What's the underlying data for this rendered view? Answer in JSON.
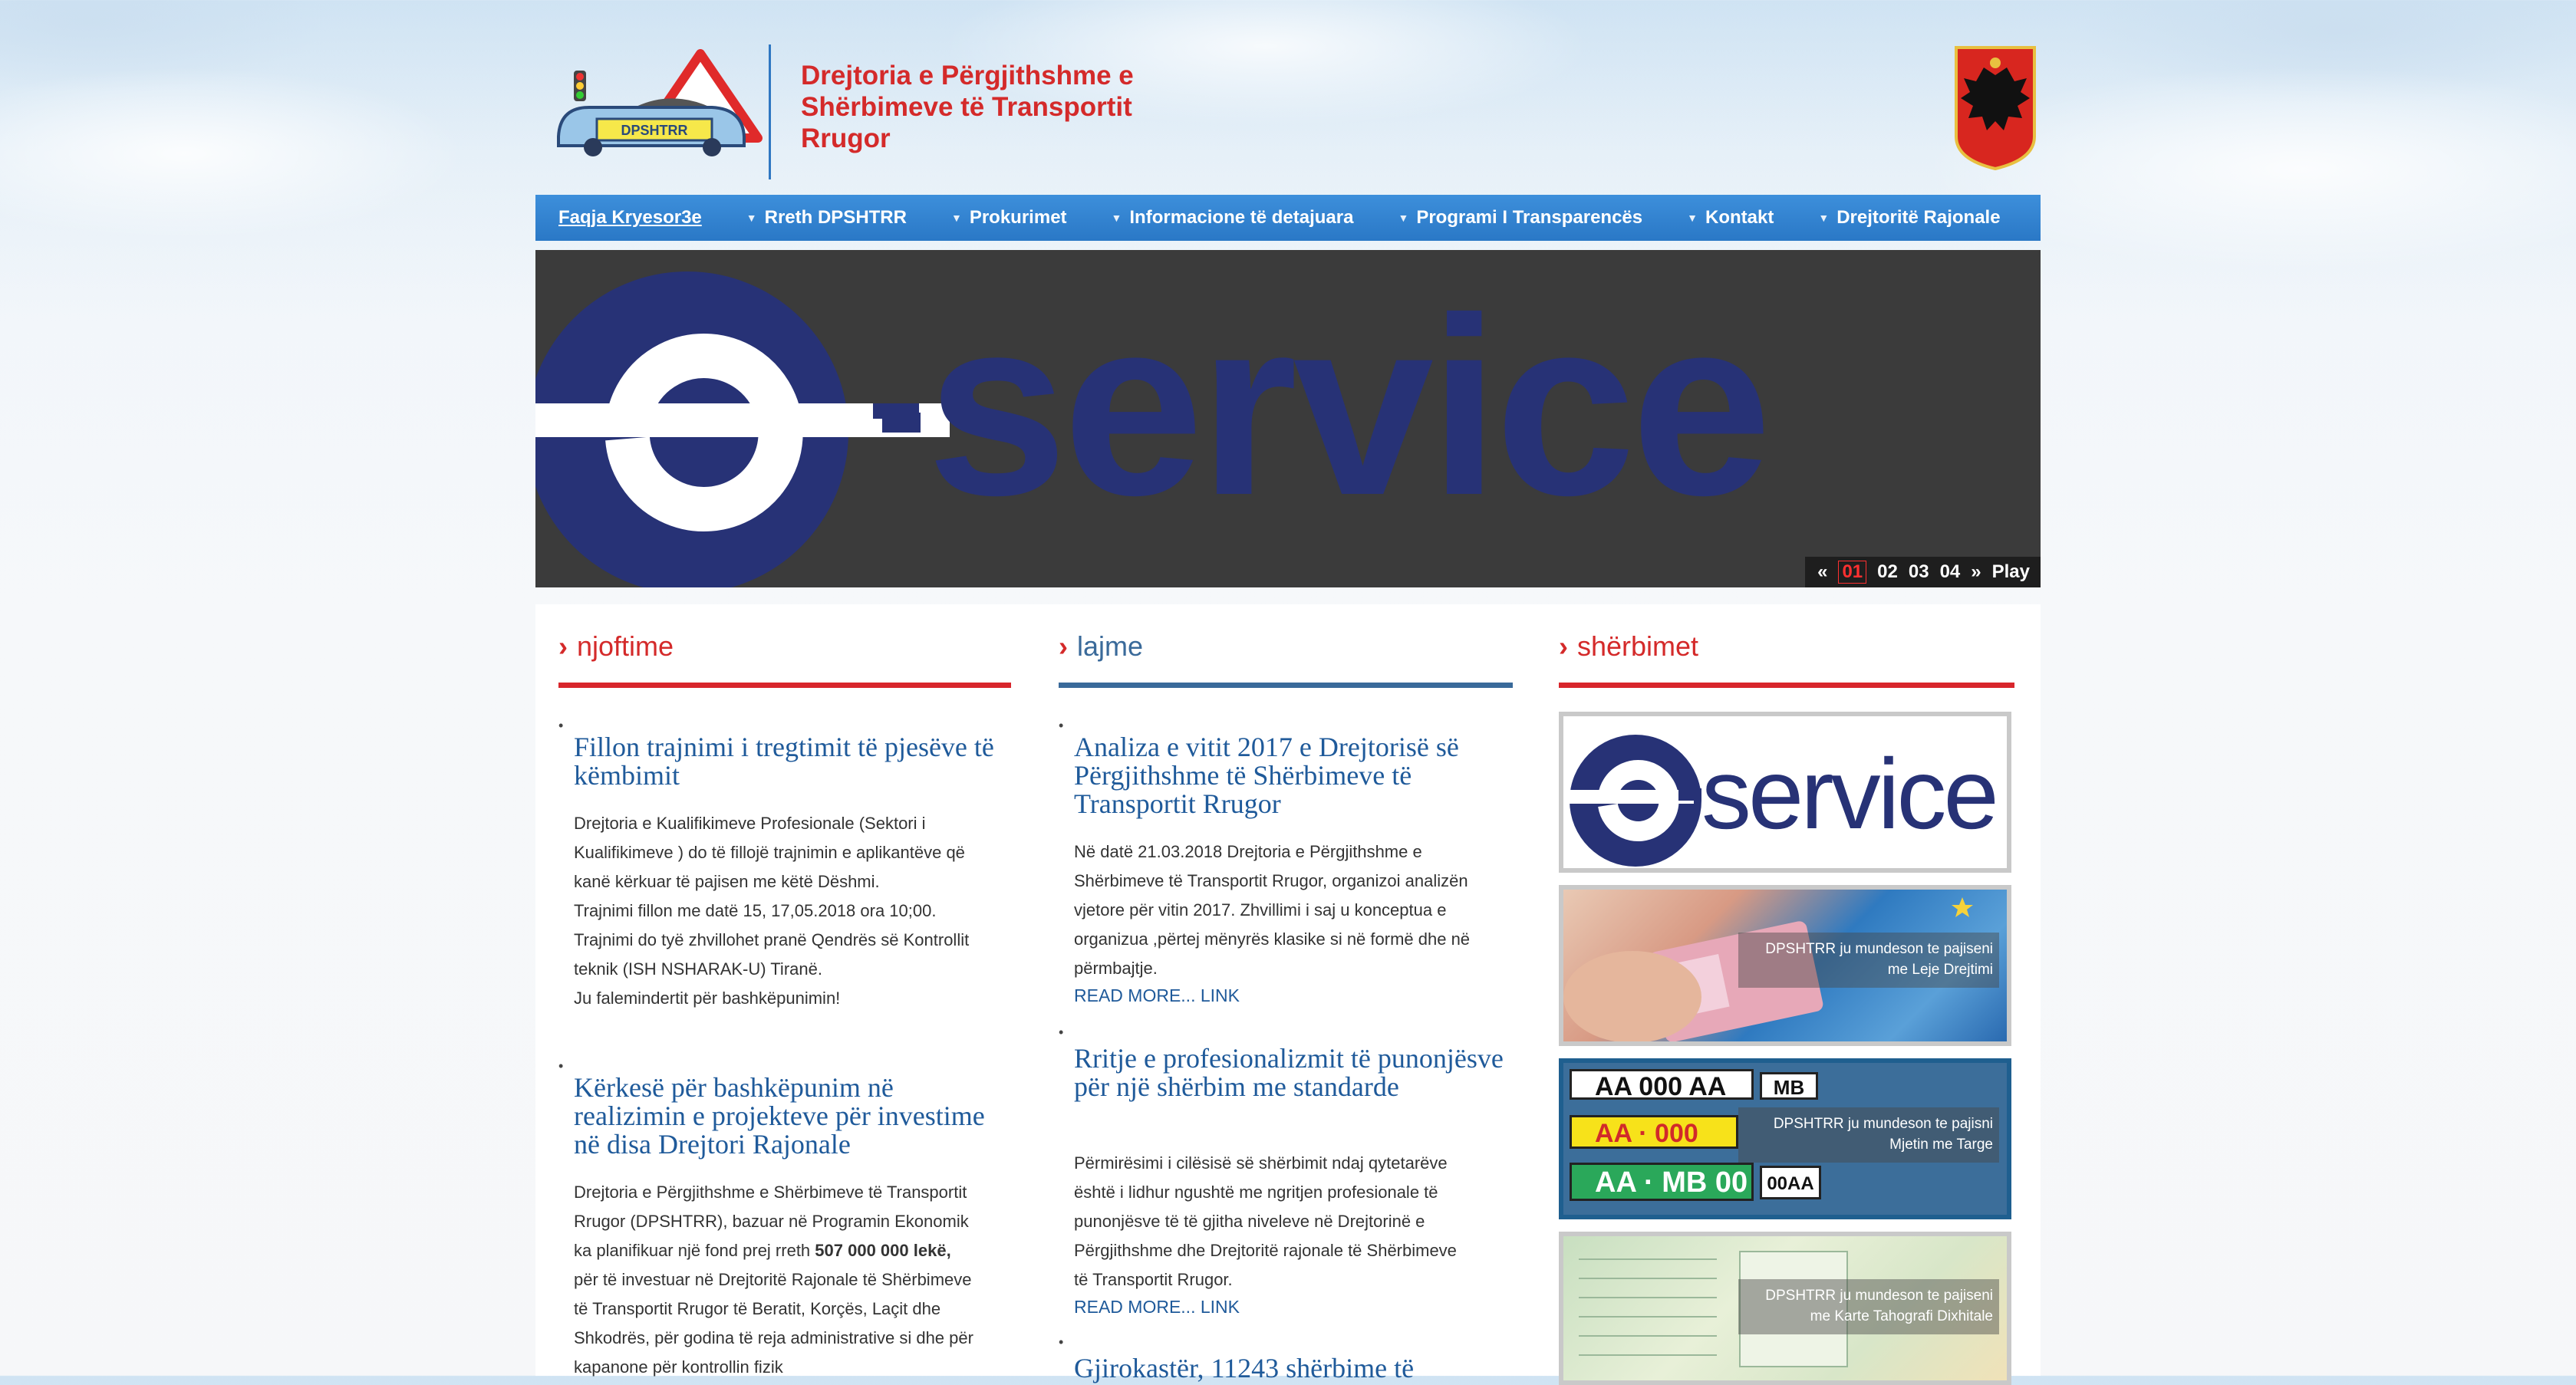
{
  "header": {
    "org_line1": "Drejtoria e Përgjithshme e",
    "org_line2": "Shërbimeve të Transportit",
    "org_line3": "Rrugor",
    "logo_text": "DPSHTRR"
  },
  "nav": {
    "items": [
      {
        "label": "Faqja Kryesor3e"
      },
      {
        "label": "Rreth DPSHTRR"
      },
      {
        "label": "Prokurimet"
      },
      {
        "label": "Informacione të detajuara"
      },
      {
        "label": "Programi I Transparencës"
      },
      {
        "label": "Kontakt"
      },
      {
        "label": "Drejtoritë Rajonale"
      }
    ]
  },
  "slider": {
    "banner_text": "service",
    "prev": "«",
    "slides": [
      "01",
      "02",
      "03",
      "04"
    ],
    "next": "»",
    "play": "Play"
  },
  "njoftime": {
    "title": "njoftime",
    "items": [
      {
        "title": "Fillon trajnimi i tregtimit të pjesëve të këmbimit",
        "lines": [
          "Drejtoria e Kualifikimeve Profesionale (Sektori i",
          "Kualifikimeve ) do të fillojë trajnimin e aplikantëve që",
          "kanë kërkuar të pajisen me këtë Dëshmi.",
          "Trajnimi fillon me datë 15, 17,05.2018 ora 10;00.",
          "Trajnimi do tyë zhvillohet pranë Qendrës së Kontrollit",
          "teknik (ISH NSHARAK-U) Tiranë.",
          "Ju falemindertit për bashkëpunimin!"
        ]
      },
      {
        "title": "Kërkesë për bashkëpunim në realizimin e projekteve për investime në disa Drejtori Rajonale",
        "lines": [
          "Drejtoria e Përgjithshme e Shërbimeve të Transportit",
          "Rrugor (DPSHTRR), bazuar në Programin Ekonomik",
          "ka planifikuar një fond prej rreth",
          "për të investuar në Drejtoritë Rajonale të Shërbimeve",
          "të Transportit Rrugor të Beratit, Korçës, Laçit dhe",
          "Shkodrës, për godina të reja administrative si dhe për",
          "kapanone për kontrollin fizik"
        ],
        "bold_amount": "507 000 000 lekë,"
      }
    ]
  },
  "lajme": {
    "title": "lajme",
    "items": [
      {
        "title": "Analiza e vitit 2017 e Drejtorisë së Përgjithshme të Shërbimeve të Transportit Rrugor",
        "lines": [
          "Në datë 21.03.2018 Drejtoria e Përgjithshme e",
          "Shërbimeve të Transportit Rrugor, organizoi analizën",
          "vjetore për vitin 2017. Zhvillimi i saj u konceptua e",
          "organizua ,përtej mënyrës klasike si në formë dhe në",
          "përmbajtje."
        ],
        "read_more": "READ MORE... LINK"
      },
      {
        "title": "Rritje e profesionalizmit të punonjësve për një shërbim me standarde",
        "lines": [
          "Përmirësimi i cilësisë së shërbimit ndaj qytetarëve",
          "është i lidhur ngushtë me ngritjen profesionale të",
          "punonjësve të të gjitha niveleve në Drejtorinë e",
          "Përgjithshme dhe Drejtoritë rajonale të Shërbimeve",
          "të Transportit Rrugor."
        ],
        "read_more": "READ MORE... LINK"
      },
      {
        "title": "Gjirokastër, 11243 shërbime të"
      }
    ]
  },
  "sherbimet": {
    "title": "shërbimet",
    "eservice_text": "service",
    "cards": [
      {
        "line1": "DPSHTRR ju mundeson te pajiseni",
        "line2": "me Leje Drejtimi"
      },
      {
        "line1": "DPSHTRR ju mundeson te pajisni",
        "line2": "Mjetin me Targe"
      },
      {
        "line1": "DPSHTRR ju mundeson te pajiseni",
        "line2": "me Karte Tahografi Dixhitale"
      }
    ],
    "plates": [
      "AA 000 AA",
      "MB",
      "AA · 000",
      "AA · MB 00",
      "00AA"
    ]
  },
  "colors": {
    "nav_blue": "#2f80cf",
    "red": "#d42a2a",
    "news_blue": "#3a6a9a",
    "title_blue": "#1f5a9a"
  }
}
